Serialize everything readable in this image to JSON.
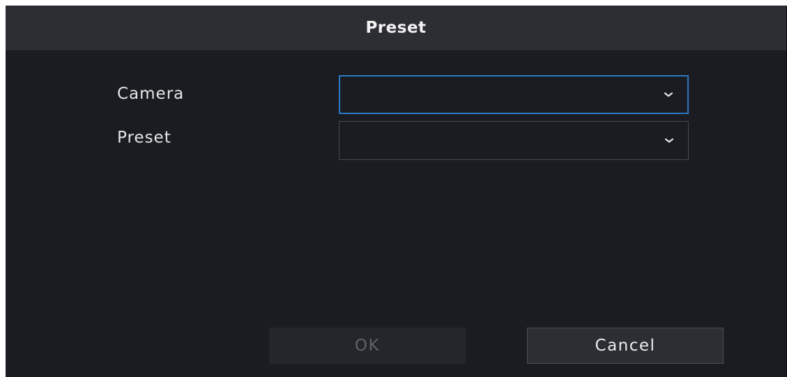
{
  "dialog": {
    "title": "Preset"
  },
  "form": {
    "camera": {
      "label": "Camera",
      "value": "",
      "chevron_icon": "chevron-down-icon"
    },
    "preset": {
      "label": "Preset",
      "value": "",
      "chevron_icon": "chevron-down-icon"
    }
  },
  "buttons": {
    "ok_label": "OK",
    "cancel_label": "Cancel"
  },
  "colors": {
    "background": "#1a1c21",
    "title_bar": "#2c2e34",
    "focus_border": "#2b79c2",
    "disabled_text": "#5e6168"
  }
}
